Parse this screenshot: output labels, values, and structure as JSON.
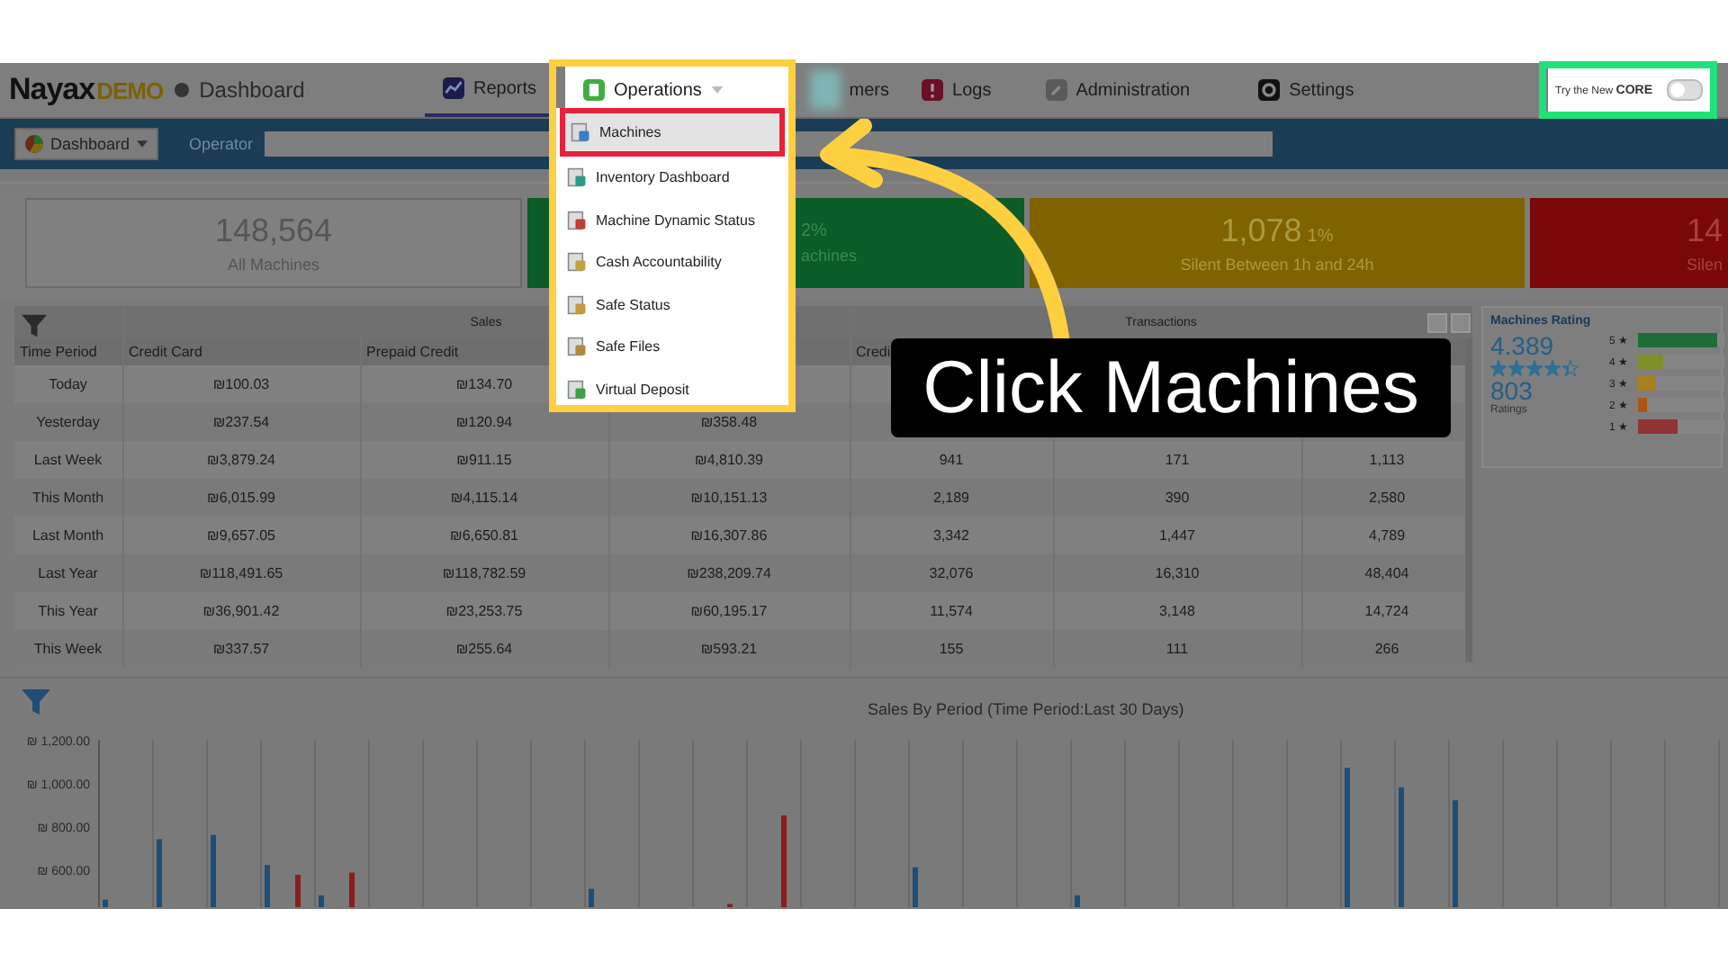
{
  "header": {
    "logo": "Nayax",
    "logo_suffix": "DEMO",
    "page": "Dashboard"
  },
  "nav": [
    {
      "label": "Reports",
      "kind": "reports",
      "selected": true,
      "open": false
    },
    {
      "label": "Operations",
      "kind": "operations",
      "selected": false,
      "open": true
    },
    {
      "label": "mers",
      "kind": "blurred",
      "selected": false,
      "open": false
    },
    {
      "label": "Logs",
      "kind": "logs",
      "selected": false,
      "open": false
    },
    {
      "label": "Administration",
      "kind": "admin",
      "selected": false,
      "open": false
    },
    {
      "label": "Settings",
      "kind": "settings",
      "selected": false,
      "open": false
    }
  ],
  "core_toggle": {
    "label": "Try the New",
    "brand": "CORE",
    "on": false
  },
  "toolbar": {
    "view": "Dashboard",
    "operator_label": "Operator"
  },
  "kpis": [
    {
      "value": "148,564",
      "label": "All Machines",
      "color": "#808080"
    },
    {
      "percent": "2%",
      "label": "achines",
      "color": "#0b5c27"
    },
    {
      "value": "1,078",
      "percent": "1%",
      "label": "Silent Between 1h and 24h",
      "color": "#7f6300"
    },
    {
      "value": "14",
      "label": "Silen",
      "color": "#7a0808"
    }
  ],
  "operations_menu": [
    {
      "label": "Machines",
      "selected": true
    },
    {
      "label": "Inventory Dashboard",
      "selected": false
    },
    {
      "label": "Machine Dynamic Status",
      "selected": false
    },
    {
      "label": "Cash Accountability",
      "selected": false
    },
    {
      "label": "Safe Status",
      "selected": false
    },
    {
      "label": "Safe Files",
      "selected": false
    },
    {
      "label": "Virtual Deposit",
      "selected": false
    }
  ],
  "table": {
    "groups": [
      {
        "label": "Sales"
      },
      {
        "label": "Transactions"
      }
    ],
    "columns": [
      "Time Period",
      "Credit Card",
      "Prepaid Credit",
      null,
      "Credi",
      null,
      null
    ],
    "rows": [
      [
        "Today",
        "₪100.03",
        "₪134.70",
        null,
        null,
        null,
        null
      ],
      [
        "Yesterday",
        "₪237.54",
        "₪120.94",
        "₪358.48",
        null,
        null,
        null
      ],
      [
        "Last Week",
        "₪3,879.24",
        "₪911.15",
        "₪4,810.39",
        "941",
        "171",
        "1,113"
      ],
      [
        "This Month",
        "₪6,015.99",
        "₪4,115.14",
        "₪10,151.13",
        "2,189",
        "390",
        "2,580"
      ],
      [
        "Last Month",
        "₪9,657.05",
        "₪6,650.81",
        "₪16,307.86",
        "3,342",
        "1,447",
        "4,789"
      ],
      [
        "Last Year",
        "₪118,491.65",
        "₪118,782.59",
        "₪238,209.74",
        "32,076",
        "16,310",
        "48,404"
      ],
      [
        "This Year",
        "₪36,901.42",
        "₪23,253.75",
        "₪60,195.17",
        "11,574",
        "3,148",
        "14,724"
      ],
      [
        "This Week",
        "₪337.57",
        "₪255.64",
        "₪593.21",
        "155",
        "111",
        "266"
      ]
    ]
  },
  "rating": {
    "title": "Machines Rating",
    "score": "4.389",
    "stars": 4.4,
    "count": "803",
    "count_label": "Ratings",
    "bars": [
      {
        "label": "5 ★",
        "level": 0.92,
        "color": "#1d6e36"
      },
      {
        "label": "4 ★",
        "level": 0.3,
        "color": "#7f8f2a"
      },
      {
        "label": "3 ★",
        "level": 0.2,
        "color": "#a8801c"
      },
      {
        "label": "2 ★",
        "level": 0.1,
        "color": "#ad5516"
      },
      {
        "label": "1 ★",
        "level": 0.45,
        "color": "#903434"
      }
    ]
  },
  "chart": {
    "title": "Sales By Period (Time Period:Last 30 Days)",
    "axis_labels": [
      "₪ 1,200.00",
      "₪ 1,000.00",
      "₪ 800.00",
      "₪ 600.00"
    ]
  },
  "annotations": {
    "callout": "Click Machines"
  }
}
